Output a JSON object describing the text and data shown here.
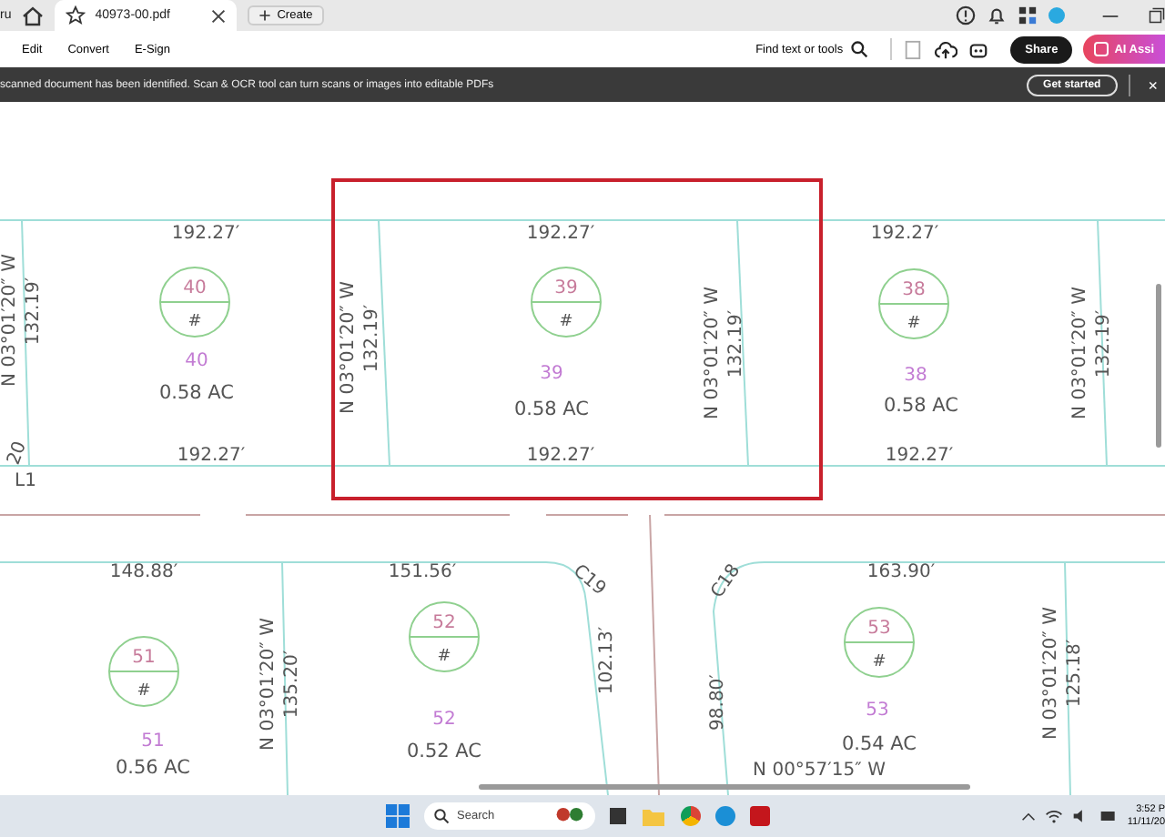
{
  "browser_tabs": {
    "partial_label": "ru",
    "document_tab": {
      "title": "40973-00.pdf",
      "selected": true
    },
    "create_label": "Create"
  },
  "toolbar": {
    "menu": [
      "Edit",
      "Convert",
      "E-Sign"
    ],
    "search_label": "Find text or tools",
    "share_label": "Share",
    "ai_label": "AI Assi"
  },
  "banner": {
    "message": "scanned document has been identified. Scan & OCR tool can turn scans or images into editable PDFs",
    "action": "Get started",
    "close": "×"
  },
  "plat": {
    "top_lots": [
      {
        "number": "40",
        "tag_mark": "#",
        "label": "40",
        "area": "0.58 AC",
        "top_dim": "192.27′",
        "bottom_dim": "192.27′",
        "highlighted": false
      },
      {
        "number": "39",
        "tag_mark": "#",
        "label": "39",
        "area": "0.58 AC",
        "top_dim": "192.27′",
        "bottom_dim": "192.27′",
        "highlighted": true
      },
      {
        "number": "38",
        "tag_mark": "#",
        "label": "38",
        "area": "0.58 AC",
        "top_dim": "192.27′",
        "bottom_dim": "192.27′",
        "highlighted": false
      }
    ],
    "top_boundaries": [
      {
        "bearing": "N 03°01′20″ W",
        "length": "132.19′"
      },
      {
        "bearing": "N 03°01′20″ W",
        "length": "132.19′"
      },
      {
        "bearing": "N 03°01′20″ W",
        "length": "132.19′"
      },
      {
        "bearing": "N 03°01′20″ W",
        "length": "132.19′"
      }
    ],
    "corner_labels": [
      "20",
      "L1"
    ],
    "bottom_lots": [
      {
        "number": "51",
        "tag_mark": "#",
        "label": "51",
        "area": "0.56 AC",
        "top_dim": "148.88′"
      },
      {
        "number": "52",
        "tag_mark": "#",
        "label": "52",
        "area": "0.52 AC",
        "top_dim": "151.56′"
      },
      {
        "number": "53",
        "tag_mark": "#",
        "label": "53",
        "area": "0.54 AC",
        "top_dim": "163.90′"
      }
    ],
    "bottom_boundaries": [
      {
        "bearing": "N 03°01′20″ W",
        "length": "135.20′"
      },
      {
        "bearing": "N 03°01′20″ W",
        "length": "125.18′"
      }
    ],
    "curves": [
      {
        "label": "C19",
        "length": "102.13′"
      },
      {
        "label": "C18",
        "length": "98.80′"
      }
    ],
    "bottom_bearing": "N 00°57′15″ W"
  },
  "taskbar": {
    "search_placeholder": "Search",
    "time": "3:52 P",
    "date": "11/11/20"
  }
}
